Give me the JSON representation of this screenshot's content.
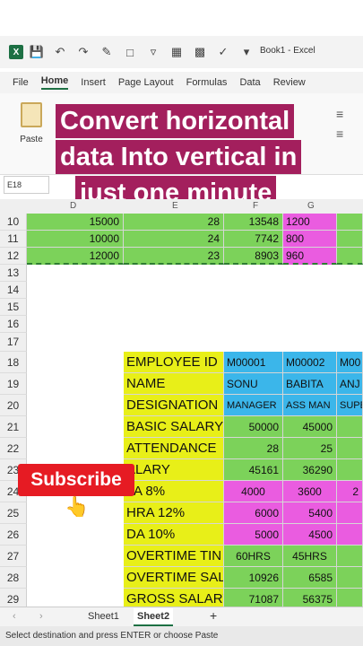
{
  "app": {
    "window_title": "Book1 - Excel",
    "name_box": "E18"
  },
  "ribbon": {
    "tabs": [
      "File",
      "Home",
      "Insert",
      "Page Layout",
      "Formulas",
      "Data",
      "Review"
    ],
    "active_tab": "Home",
    "paste_label": "Paste"
  },
  "banner": {
    "lines": [
      "Convert horizontal",
      "data Into vertical in",
      "just one minute"
    ],
    "color": "#a31f5d"
  },
  "columns": [
    "D",
    "E",
    "F",
    "G"
  ],
  "rows_top": [
    {
      "n": "10",
      "d": "15000",
      "e": "28",
      "f": "13548",
      "g": "1200"
    },
    {
      "n": "11",
      "d": "10000",
      "e": "24",
      "f": "7742",
      "g": "800"
    },
    {
      "n": "12",
      "d": "12000",
      "e": "23",
      "f": "8903",
      "g": "960"
    }
  ],
  "empty_rows": [
    "13",
    "14",
    "15",
    "16",
    "17"
  ],
  "table": {
    "header": {
      "n": "18",
      "label": "EMPLOYEE ID",
      "ids": [
        "M00001",
        "M00002",
        "M00"
      ]
    },
    "name": {
      "n": "19",
      "label": "NAME",
      "vals": [
        "SONU",
        "BABITA",
        "ANJ"
      ]
    },
    "designation": {
      "n": "20",
      "label": "DESIGNATION",
      "vals": [
        "MANAGER",
        "ASS MAN",
        "SUPE"
      ]
    },
    "basic": {
      "n": "21",
      "label": "BASIC SALARY",
      "vals": [
        "50000",
        "45000"
      ]
    },
    "attendance": {
      "n": "22",
      "label": "ATTENDANCE",
      "vals": [
        "28",
        "25"
      ]
    },
    "salary": {
      "n": "23",
      "label": "ALARY",
      "vals": [
        "45161",
        "36290"
      ]
    },
    "ta": {
      "n": "24",
      "label": "TA 8%",
      "vals": [
        "4000",
        "3600",
        "2"
      ]
    },
    "hra": {
      "n": "25",
      "label": "HRA 12%",
      "vals": [
        "6000",
        "5400"
      ]
    },
    "da": {
      "n": "26",
      "label": "DA 10%",
      "vals": [
        "5000",
        "4500"
      ]
    },
    "ot_time": {
      "n": "27",
      "label": "OVERTIME TIN",
      "vals": [
        "60HRS",
        "45HRS"
      ]
    },
    "ot_sal": {
      "n": "28",
      "label": "OVERTIME SAL",
      "vals": [
        "10926",
        "6585"
      ]
    },
    "gross": {
      "n": "29",
      "label": "GROSS SALARY",
      "vals": [
        "71087",
        "56375"
      ]
    }
  },
  "overlay": {
    "subscribe": "Subscribe",
    "hand": "👆"
  },
  "sheets": [
    "Sheet1",
    "Sheet2"
  ],
  "active_sheet": "Sheet2",
  "add_sheet": "+",
  "status_text": "Select destination and press ENTER or choose Paste"
}
